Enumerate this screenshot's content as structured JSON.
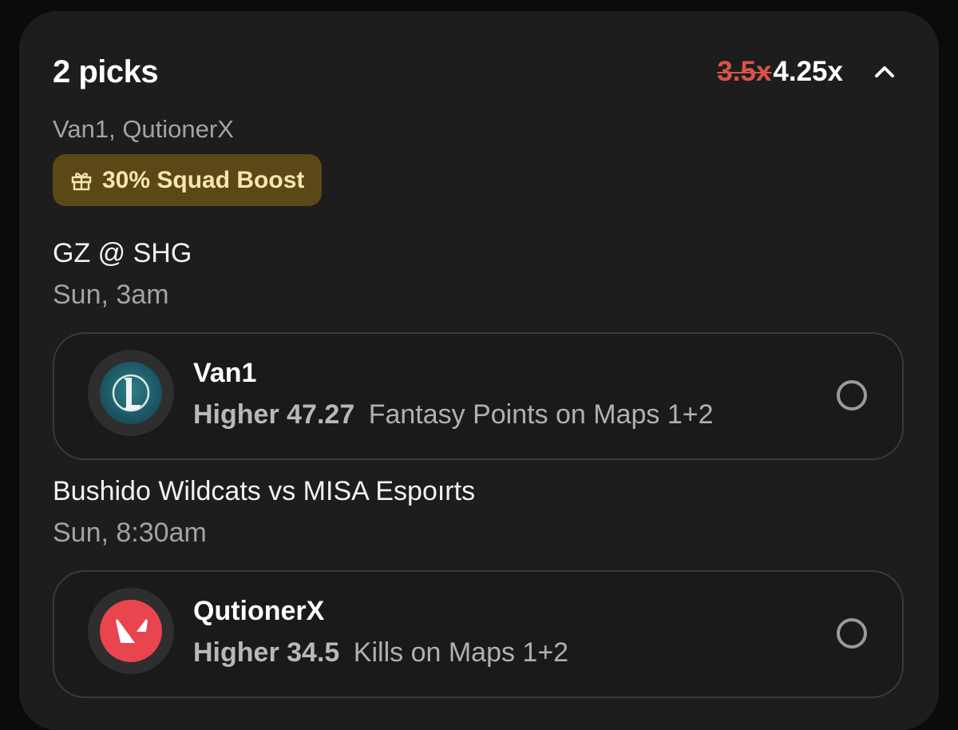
{
  "header": {
    "title": "2 picks",
    "old_multiplier": "3.5x",
    "new_multiplier": "4.25x",
    "collapse_icon": "chevron-up-icon"
  },
  "players_summary": "Van1, QutionerX",
  "boost": {
    "icon": "gift-icon",
    "label": "30% Squad Boost"
  },
  "games": [
    {
      "title": "GZ @ SHG",
      "time": "Sun, 3am",
      "pick": {
        "logo": "league-of-legends-logo",
        "player": "Van1",
        "direction": "Higher",
        "value": "47.27",
        "stat": "Fantasy Points on Maps 1+2"
      }
    },
    {
      "title": "Bushido Wildcats vs MISA Espoırts",
      "time": "Sun, 8:30am",
      "pick": {
        "logo": "valorant-logo",
        "player": "QutionerX",
        "direction": "Higher",
        "value": "34.5",
        "stat": "Kills on Maps 1+2"
      }
    }
  ],
  "colors": {
    "card_bg": "#1d1d1d",
    "strike_red": "#d9534a",
    "boost_bg": "#5a4917",
    "boost_text": "#f6e6b2"
  }
}
